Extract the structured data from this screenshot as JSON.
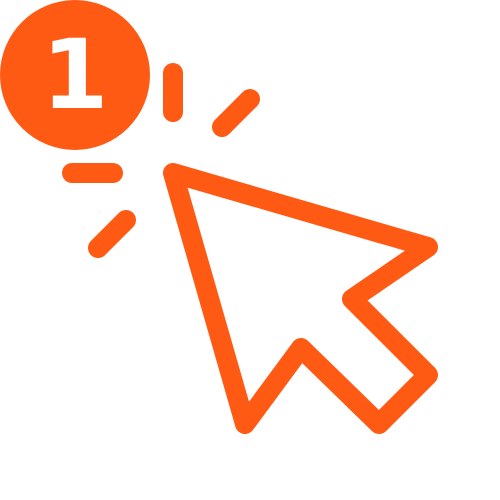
{
  "colors": {
    "accent": "#ff5a14",
    "background": "#ffffff",
    "badge_text": "#ffffff"
  },
  "badge": {
    "icon": "number-badge-icon",
    "label": "1"
  },
  "pointer": {
    "icon": "cursor-arrow-icon"
  },
  "burst": {
    "icon": "click-burst-lines-icon"
  }
}
